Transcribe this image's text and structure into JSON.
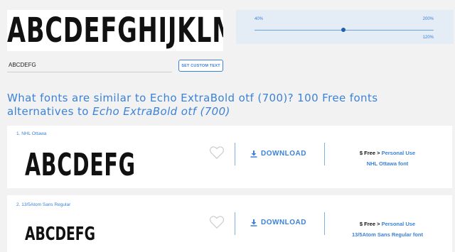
{
  "preview": {
    "text": "ABCDEFGHIJKLM"
  },
  "custom_text": {
    "value": "ABCDEFG",
    "button_label": "SET CUSTOM TEXT"
  },
  "size_slider": {
    "min_label": "40%",
    "max_label": "200%",
    "value_label": "120%",
    "value_percent": 120
  },
  "heading": {
    "line1": "What fonts are similar to Echo ExtraBold otf (700)? 100 Free fonts alternatives to ",
    "font_name": "Echo ExtraBold otf (700)"
  },
  "results": [
    {
      "title": "1. NHL Ottawa",
      "sample": "ABCDEFG",
      "download_label": "DOWNLOAD",
      "price_prefix": "$ Free > ",
      "license": "Personal Use",
      "font_link": "NHL Ottawa font"
    },
    {
      "title": "2. 13/5Atom Sans Regular",
      "sample": "ABCDEFG",
      "download_label": "DOWNLOAD",
      "price_prefix": "$ Free > ",
      "license": "Personal Use",
      "font_link": "13/5Atom Sans Regular font"
    }
  ],
  "icons": {
    "favorite": "heart-outline-icon",
    "download": "download-arrow-icon"
  },
  "colors": {
    "accent": "#3b82d8",
    "panel": "#e4ecf6",
    "background": "#f2f2f2"
  }
}
